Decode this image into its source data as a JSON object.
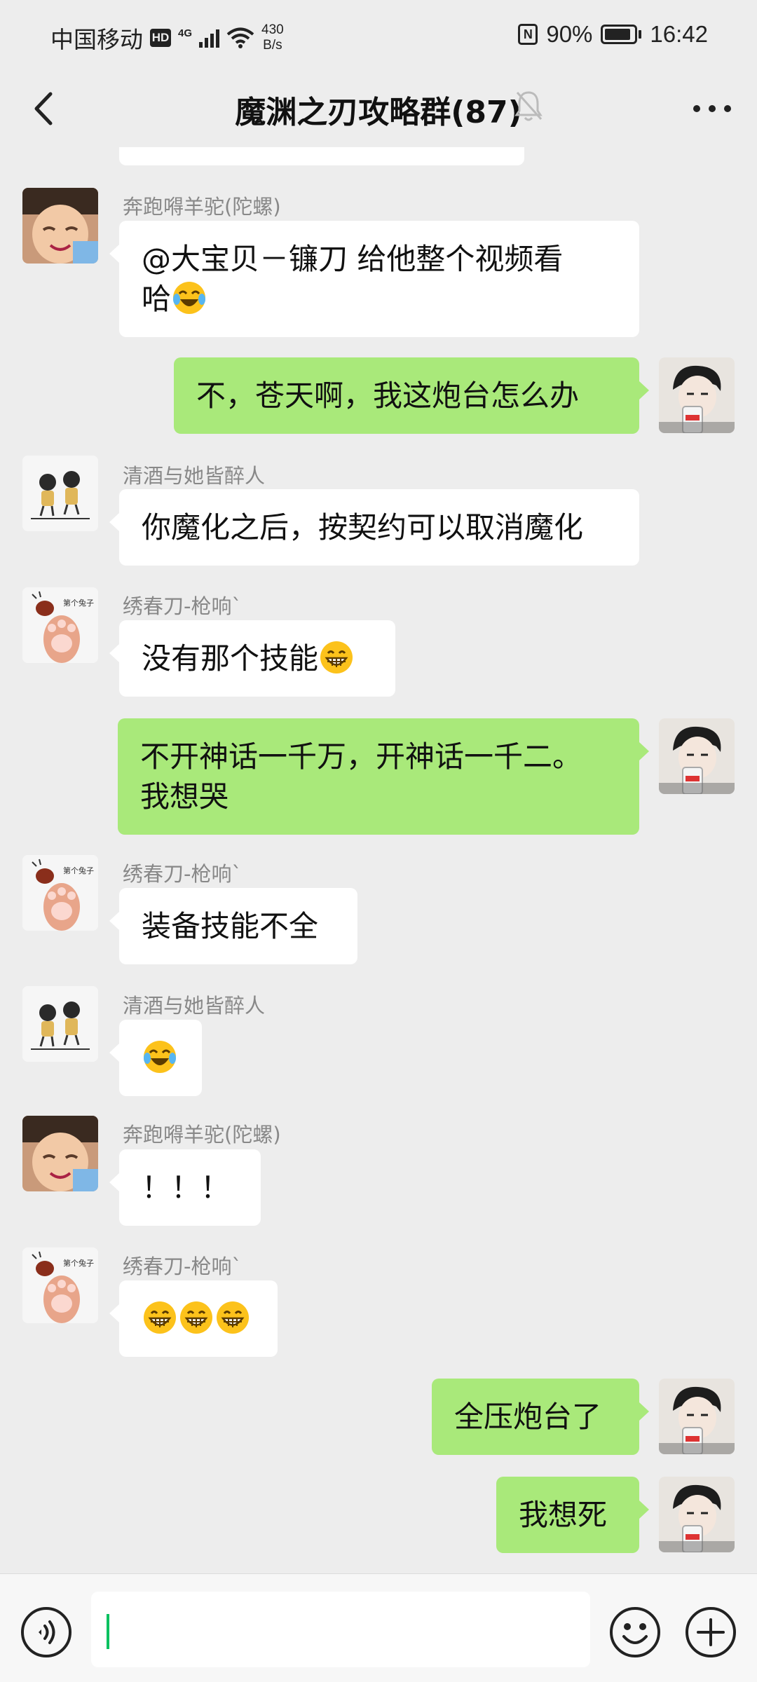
{
  "status_bar": {
    "carrier": "中国移动",
    "hd": "HD",
    "network": "4G",
    "speed_value": "430",
    "speed_unit": "B/s",
    "nfc": "N",
    "battery_text": "90%",
    "battery_level": 0.9,
    "time": "16:42"
  },
  "header": {
    "title": "魔渊之刃攻略群(87)",
    "back_icon": "chevron-left-icon",
    "mute_icon": "bell-muted-icon",
    "more_icon": "more-dots-icon"
  },
  "messages": [
    {
      "side": "in",
      "sender": "奔跑嘚羊驼(陀螺)",
      "avatar": "avatar-boy-photo",
      "text": "@大宝贝－镰刀  给他整个视频看\n哈",
      "emoji_after": "laugh-tears"
    },
    {
      "side": "out",
      "sender": "",
      "avatar": "avatar-self-anime",
      "text": "不，苍天啊，我这炮台怎么办"
    },
    {
      "side": "in",
      "sender": "清酒与她皆醉人",
      "avatar": "avatar-couple-cartoon",
      "text": "你魔化之后，按契约可以取消魔化"
    },
    {
      "side": "in",
      "sender": "绣春刀-枪响`",
      "avatar": "avatar-paw",
      "text": "没有那个技能",
      "emoji_after": "grin"
    },
    {
      "side": "out",
      "sender": "",
      "avatar": "avatar-self-anime",
      "text": "不开神话一千万，开神话一千二。\n我想哭"
    },
    {
      "side": "in",
      "sender": "绣春刀-枪响`",
      "avatar": "avatar-paw",
      "text": "装备技能不全"
    },
    {
      "side": "in",
      "sender": "清酒与她皆醉人",
      "avatar": "avatar-couple-cartoon",
      "text": "",
      "emoji_after": "laugh-tears"
    },
    {
      "side": "in",
      "sender": "奔跑嘚羊驼(陀螺)",
      "avatar": "avatar-boy-photo",
      "text": "！！！"
    },
    {
      "side": "in",
      "sender": "绣春刀-枪响`",
      "avatar": "avatar-paw",
      "text": "",
      "emoji_after": "grin-x3"
    },
    {
      "side": "out",
      "sender": "",
      "avatar": "avatar-self-anime",
      "text": "全压炮台了"
    },
    {
      "side": "out",
      "sender": "",
      "avatar": "avatar-self-anime",
      "text": "我想死"
    }
  ],
  "input_bar": {
    "voice_icon": "voice-icon",
    "emoji_icon": "emoji-icon",
    "plus_icon": "plus-icon",
    "text_value": ""
  }
}
